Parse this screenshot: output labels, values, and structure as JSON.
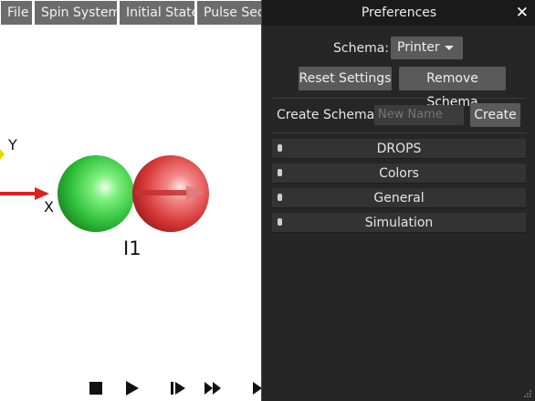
{
  "menu": {
    "items": [
      "File",
      "Spin System",
      "Initial State",
      "Pulse Sequ"
    ]
  },
  "scene": {
    "axis_y": "Y",
    "axis_x": "X",
    "spin_label": "I1",
    "colors": {
      "spin_green": "#3fcf4f",
      "spin_red": "#e04848",
      "axis_red": "#e02020",
      "axis_yellow": "#e8d800"
    }
  },
  "playback": {
    "icons": [
      "stop-icon",
      "play-icon",
      "step-forward-icon",
      "fast-forward-icon",
      "next-icon"
    ]
  },
  "preferences": {
    "title": "Preferences",
    "close_glyph": "✕",
    "schema_label": "Schema:",
    "schema_value": "Printer",
    "reset_button": "Reset Settings",
    "remove_button": "Remove Schema",
    "create_label": "Create Schema:",
    "create_placeholder": "New Name",
    "create_button": "Create",
    "sections": [
      "DROPS",
      "Colors",
      "General",
      "Simulation"
    ]
  }
}
